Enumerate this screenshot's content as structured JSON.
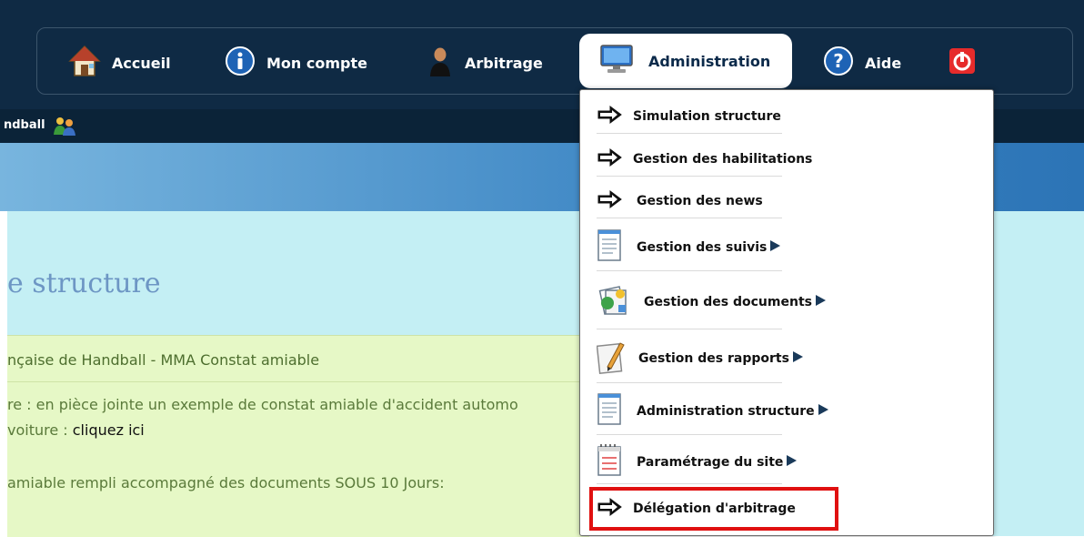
{
  "nav": {
    "items": [
      {
        "label": "Accueil",
        "icon": "home-icon"
      },
      {
        "label": "Mon compte",
        "icon": "info-icon"
      },
      {
        "label": "Arbitrage",
        "icon": "referee-icon"
      },
      {
        "label": "Administration",
        "icon": "monitor-icon",
        "active": true
      },
      {
        "label": "Aide",
        "icon": "help-icon"
      }
    ],
    "power_icon": "power-icon"
  },
  "subbar": {
    "text": "ndball"
  },
  "page": {
    "title": "e structure"
  },
  "card": {
    "header": "nçaise de Handball - MMA Constat amiable",
    "line1": "re : en pièce jointe un exemple de constat amiable d'accident automo",
    "line2_prefix": "voiture : ",
    "line2_link": "cliquez ici",
    "line3": "amiable rempli accompagné des documents SOUS 10 Jours:"
  },
  "dropdown": {
    "items": [
      {
        "label": "Simulation structure",
        "icon": "arrow-icon"
      },
      {
        "label": "Gestion des habilitations",
        "icon": "arrow-icon"
      },
      {
        "label": "Gestion des news",
        "icon": "arrow-icon"
      },
      {
        "label": "Gestion des suivis",
        "icon": "document-icon",
        "submenu": true
      },
      {
        "label": "Gestion des documents",
        "icon": "documents-icon",
        "submenu": true
      },
      {
        "label": "Gestion des rapports",
        "icon": "report-icon",
        "submenu": true
      },
      {
        "label": "Administration structure",
        "icon": "document-icon",
        "submenu": true
      },
      {
        "label": "Paramétrage du site",
        "icon": "notepad-icon",
        "submenu": true
      },
      {
        "label": "Délégation d'arbitrage",
        "icon": "arrow-icon",
        "highlighted": true
      }
    ]
  },
  "colors": {
    "navy": "#0f2a44",
    "highlight": "#e01010",
    "content_bg": "#c4eff4",
    "card_bg": "#e6f8c6"
  }
}
